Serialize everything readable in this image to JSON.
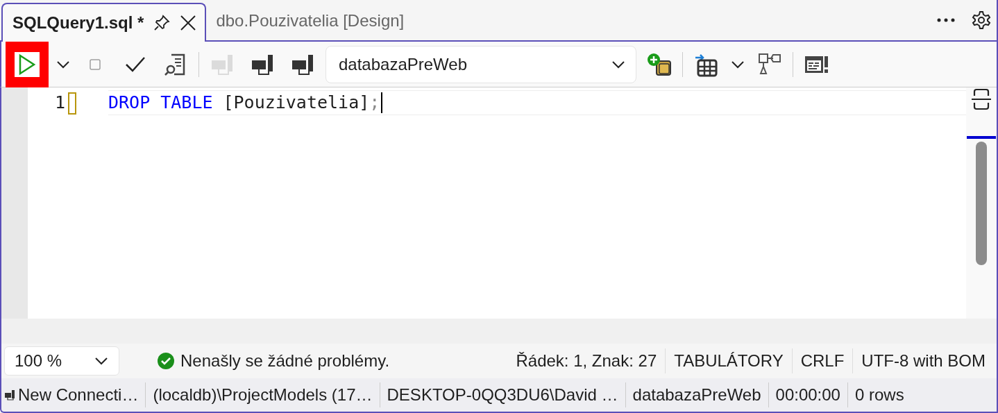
{
  "tabs": [
    {
      "label": "SQLQuery1.sql *",
      "selected": true
    },
    {
      "label": "dbo.Pouzivatelia [Design]",
      "selected": false
    }
  ],
  "toolbar": {
    "tools": [
      {
        "kind": "execute",
        "disabled": false,
        "highlighted": true
      },
      {
        "kind": "caret",
        "disabled": false,
        "highlighted": false
      },
      {
        "kind": "stop",
        "disabled": true,
        "highlighted": false
      },
      {
        "kind": "parse",
        "disabled": false,
        "highlighted": false
      },
      {
        "kind": "plan",
        "disabled": false,
        "highlighted": false
      },
      {
        "kind": "separator"
      },
      {
        "kind": "connect",
        "disabled": true,
        "highlighted": false
      },
      {
        "kind": "connect",
        "disabled": false,
        "highlighted": false
      },
      {
        "kind": "connect",
        "disabled": false,
        "highlighted": false
      },
      {
        "kind": "add-object",
        "disabled": false,
        "highlighted": false
      },
      {
        "kind": "separator"
      },
      {
        "kind": "grid",
        "disabled": false,
        "highlighted": false
      },
      {
        "kind": "caret",
        "disabled": false,
        "highlighted": false
      },
      {
        "kind": "diagram",
        "disabled": false,
        "highlighted": false
      },
      {
        "kind": "separator"
      },
      {
        "kind": "messages",
        "disabled": false,
        "highlighted": false
      }
    ],
    "database": "databazaPreWeb"
  },
  "editor": {
    "lines": [
      {
        "number": "1",
        "tokens": [
          {
            "text": "DROP TABLE",
            "kind": "keyword"
          },
          {
            "text": "[Pouzivatelia]",
            "kind": "identifier"
          },
          {
            "text": ";",
            "kind": "punctuation"
          }
        ]
      }
    ]
  },
  "status": {
    "zoom": "100 %",
    "problems": "Nenašly se žádné problémy.",
    "items": [
      "Řádek: 1, Znak: 27",
      "TABULÁTORY",
      "CRLF",
      "UTF-8 with BOM"
    ]
  },
  "connection_bar": [
    "New  Connecti…",
    "(localdb)\\ProjectModels (17…",
    "DESKTOP-0QQ3DU6\\David …",
    "databazaPreWeb",
    "00:00:00",
    "0 rows"
  ]
}
